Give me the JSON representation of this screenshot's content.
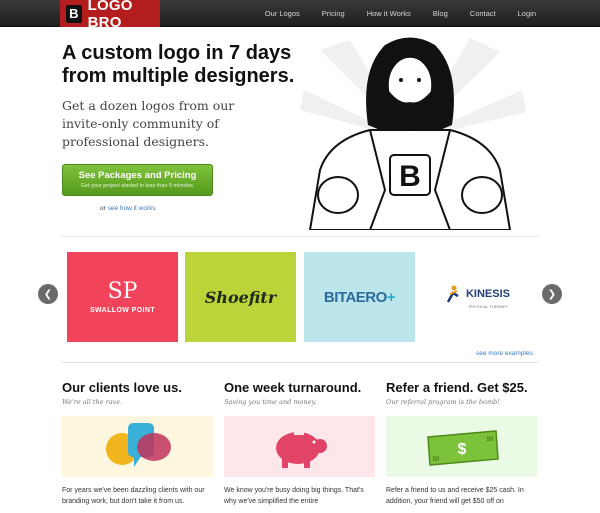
{
  "header": {
    "logo_mark": "B",
    "logo_text": "LOGO BRO",
    "nav": [
      "Our Logos",
      "Pricing",
      "How it Works",
      "Blog",
      "Contact",
      "Login"
    ]
  },
  "hero": {
    "title": "A custom logo in 7 days from multiple designers.",
    "subtitle": "Get a dozen logos from our invite-only community of professional designers.",
    "cta_label": "See Packages and Pricing",
    "cta_sub": "Get your project started in less than 5 minutes.",
    "or_text": "or",
    "how_link": "see how it works",
    "shirt_mark": "B"
  },
  "carousel": {
    "tiles": [
      {
        "mark": "SP",
        "name": "SWALLOW POINT"
      },
      {
        "name": "Shoefitr"
      },
      {
        "name": "BITAERO",
        "suffix": "+"
      },
      {
        "name": "KINESIS",
        "sub": "PHYSICAL THERAPY"
      }
    ],
    "see_more": "see more examples",
    "prev_icon": "chevron-left-icon",
    "next_icon": "chevron-right-icon"
  },
  "features": [
    {
      "title": "Our clients love us.",
      "tagline": "We're all the rave.",
      "text": "For years we've been dazzling clients with our branding work, but don't take it from us.",
      "icon": "speech-bubbles-icon"
    },
    {
      "title": "One week turnaround.",
      "tagline": "Saving you time and money.",
      "text": "We know you're busy doing big things. That's why we've simplified the entire",
      "icon": "piggy-bank-icon"
    },
    {
      "title": "Refer a friend. Get $25.",
      "tagline": "Our referral program is the bomb!",
      "text": "Refer a friend to us and receive $25 cash. In addition, your friend will get $50 off on",
      "icon": "dollar-bill-icon",
      "bill_symbol": "$",
      "bill_value": "50"
    }
  ],
  "colors": {
    "brand_red": "#b31d1d",
    "cta_green": "#6aae2a",
    "link_blue": "#3a7bbf"
  }
}
